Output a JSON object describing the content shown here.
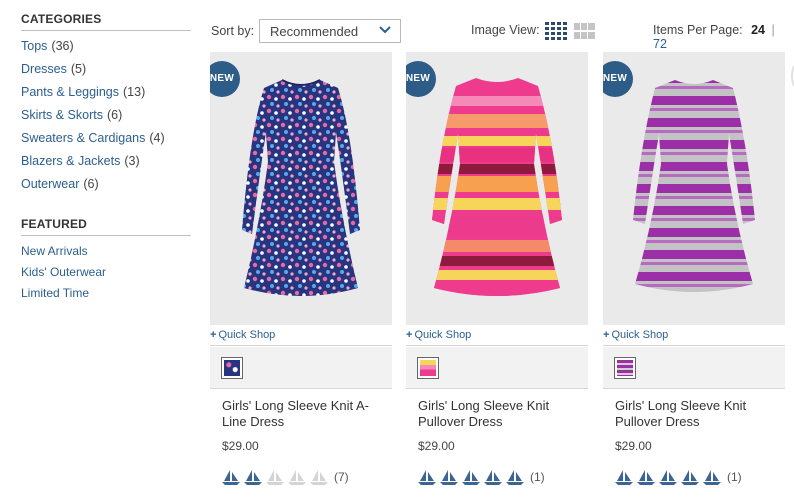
{
  "sidebar": {
    "categories_heading": "CATEGORIES",
    "categories": [
      {
        "label": "Tops",
        "count": "(36)"
      },
      {
        "label": "Dresses",
        "count": "(5)"
      },
      {
        "label": "Pants & Leggings",
        "count": "(13)"
      },
      {
        "label": "Skirts & Skorts",
        "count": "(6)"
      },
      {
        "label": "Sweaters & Cardigans",
        "count": "(4)"
      },
      {
        "label": "Blazers & Jackets",
        "count": "(3)"
      },
      {
        "label": "Outerwear",
        "count": "(6)"
      }
    ],
    "featured_heading": "FEATURED",
    "featured": [
      "New Arrivals",
      "Kids' Outerwear",
      "Limited Time"
    ]
  },
  "toolbar": {
    "sort_label": "Sort by:",
    "sort_value": "Recommended",
    "image_view_label": "Image View:",
    "items_per_page_label": "Items Per Page:",
    "per_page_active": "24",
    "per_page_sep": "|",
    "per_page_other": "72"
  },
  "products": [
    {
      "badge": "NEW",
      "quick_shop": "Quick Shop",
      "name": "Girls' Long Sleeve Knit A-Line Dress",
      "price": "$29.00",
      "rating": 2,
      "max_rating": 5,
      "review_count": "(7)",
      "icon": "floral-dress",
      "colors": {
        "body": "#2a3a8c",
        "accent": "#e86fa0"
      }
    },
    {
      "badge": "NEW",
      "quick_shop": "Quick Shop",
      "name": "Girls' Long Sleeve Knit Pullover Dress",
      "price": "$29.00",
      "rating": 5,
      "max_rating": 5,
      "review_count": "(1)",
      "icon": "striped-dress",
      "colors": {
        "body": "#ee3d8e",
        "accent": "#f6d55a"
      }
    },
    {
      "badge": "NEW",
      "quick_shop": "Quick Shop",
      "name": "Girls' Long Sleeve Knit Pullover Dress",
      "price": "$29.00",
      "rating": 5,
      "max_rating": 5,
      "review_count": "(1)",
      "icon": "striped-dress",
      "colors": {
        "body": "#9b2fa6",
        "accent": "#c9c9c9"
      }
    }
  ],
  "colors": {
    "link": "#2b5f8f",
    "badge": "#2d5c88",
    "rating_on": "#3b6592",
    "rating_off": "#d4d4d4"
  }
}
